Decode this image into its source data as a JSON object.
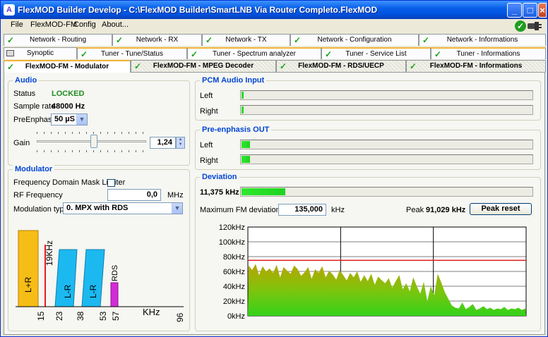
{
  "window": {
    "title": "FlexMOD Builder Develop  - C:\\FlexMOD Builder\\SmartLNB Via Router Completo.FlexMOD"
  },
  "menu": [
    "File",
    "FlexMOD-FM",
    "Config",
    "About..."
  ],
  "tabs_row1": [
    "Network - Routing",
    "Network - RX",
    "Network - TX",
    "Network - Configuration",
    "Network - Informations"
  ],
  "tabs_row2": [
    "Synoptic",
    "Tuner - Tune/Status",
    "Tuner - Spectrum analyzer",
    "Tuner - Service List",
    "Tuner - Informations"
  ],
  "tabs_row3": [
    "FlexMOD-FM - Modulator",
    "FlexMOD-FM - MPEG Decoder",
    "FlexMOD-FM - RDS/UECP",
    "FlexMOD-FM - Informations"
  ],
  "audio": {
    "title": "Audio",
    "status_label": "Status",
    "status_value": "LOCKED",
    "sample_rate_label": "Sample rate",
    "sample_rate_value": "48000 Hz",
    "preemphasis_label": "PreEnphasis",
    "preemphasis_value": "50 µS",
    "gain_label": "Gain",
    "gain_value": "1,24",
    "gain_level": 0.52
  },
  "modulator": {
    "title": "Modulator",
    "mask_limiter_label": "Frequency Domain Mask Limiter",
    "rf_label": "RF Frequency",
    "rf_value": "0,0",
    "rf_unit": "MHz",
    "mod_type_label": "Modulation type",
    "mod_type_value": "0. MPX with RDS",
    "spectrum": {
      "blocks": [
        "L+R",
        "L-R",
        "L-R",
        "RDS"
      ],
      "pilot": "19KHz",
      "ticks": [
        "15",
        "23",
        "38",
        "53",
        "57"
      ],
      "unit": "KHz",
      "end": "96"
    }
  },
  "pcm": {
    "title": "PCM Audio Input",
    "left_label": "Left",
    "right_label": "Right",
    "left_level": 0.005,
    "right_level": 0.005
  },
  "preemph_out": {
    "title": "Pre-enphasis OUT",
    "left_label": "Left",
    "right_label": "Right",
    "left_level": 0.03,
    "right_level": 0.03
  },
  "deviation": {
    "title": "Deviation",
    "current": "11,375 kHz",
    "current_level": 0.15,
    "max_label": "Maximum FM deviation",
    "max_value": "135,000",
    "max_unit": "kHz",
    "peak_label": "Peak",
    "peak_value": "91,029 kHz",
    "peak_reset": "Peak reset"
  },
  "chart_data": {
    "type": "area",
    "y_ticks": [
      "120kHz",
      "100kHz",
      "80kHz",
      "60kHz",
      "40kHz",
      "20kHz",
      "0kHz"
    ],
    "ylim": [
      0,
      120
    ],
    "limit_line": 75,
    "values": [
      68,
      62,
      70,
      55,
      67,
      60,
      64,
      58,
      69,
      52,
      66,
      61,
      57,
      68,
      63,
      54,
      59,
      66,
      50,
      63,
      58,
      67,
      52,
      61,
      56,
      49,
      62,
      55,
      48,
      58,
      52,
      60,
      46,
      55,
      47,
      57,
      42,
      53,
      48,
      44,
      51,
      38,
      47,
      55,
      36,
      44,
      33,
      52,
      40,
      30,
      46,
      20,
      40,
      28,
      57,
      45,
      32,
      23,
      14,
      11,
      10,
      18,
      9,
      12,
      16,
      8,
      10,
      13,
      9,
      11,
      8,
      10,
      9,
      12,
      8,
      10,
      9,
      11,
      8,
      10
    ]
  }
}
